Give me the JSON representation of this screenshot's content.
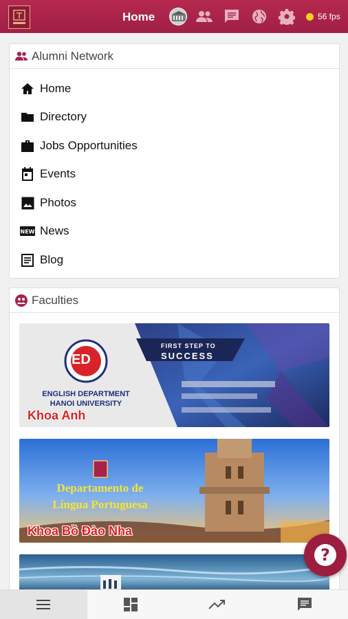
{
  "topbar": {
    "title": "Home",
    "fps": "56 fps",
    "logo_alt": "HANOI"
  },
  "alumni": {
    "title": "Alumni Network",
    "items": [
      {
        "label": "Home",
        "icon": "home-icon"
      },
      {
        "label": "Directory",
        "icon": "folder-icon"
      },
      {
        "label": "Jobs Opportunities",
        "icon": "briefcase-icon"
      },
      {
        "label": "Events",
        "icon": "calendar-icon"
      },
      {
        "label": "Photos",
        "icon": "photo-icon"
      },
      {
        "label": "News",
        "icon": "new-badge-icon"
      },
      {
        "label": "Blog",
        "icon": "article-icon"
      }
    ]
  },
  "faculties": {
    "title": "Faculties",
    "banners": [
      {
        "caption": "Khoa Anh",
        "dept_line1": "ENGLISH DEPARTMENT",
        "dept_line2": "HANOI UNIVERSITY",
        "logo_text": "ED",
        "tag_top": "FIRST STEP TO",
        "tag_bottom": "SUCCESS"
      },
      {
        "caption": "Khoa Bồ Đào Nha",
        "line1": "Departamento de",
        "line2": "Língua Portuguesa"
      },
      {
        "caption": ""
      }
    ]
  },
  "colors": {
    "brand": "#a8224a",
    "accent_yellow": "#f7cf1c"
  },
  "bottom_nav": [
    "menu-icon",
    "dashboard-icon",
    "trending-icon",
    "chat-icon"
  ]
}
